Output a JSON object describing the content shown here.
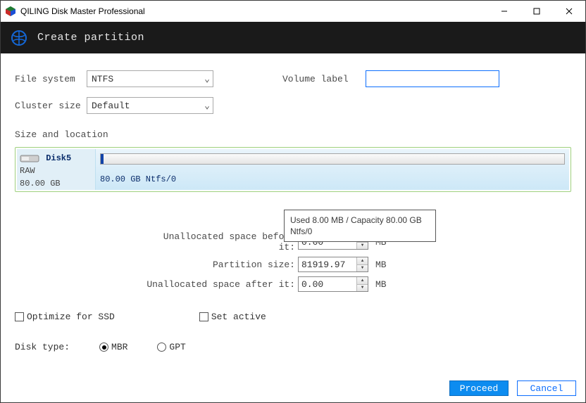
{
  "window": {
    "title": "QILING Disk Master Professional"
  },
  "header": {
    "title": "Create partition"
  },
  "labels": {
    "file_system": "File system",
    "cluster_size": "Cluster size",
    "volume_label": "Volume label",
    "size_location": "Size and location",
    "unalloc_before": "Unallocated space before it:",
    "partition_size": "Partition size:",
    "unalloc_after": "Unallocated space after it:",
    "unit_mb": "MB",
    "optimize_ssd": "Optimize for SSD",
    "set_active": "Set active",
    "disk_type": "Disk type:",
    "mbr": "MBR",
    "gpt": "GPT"
  },
  "values": {
    "file_system": "NTFS",
    "cluster_size": "Default",
    "volume_label": "",
    "unalloc_before": "0.00",
    "partition_size": "81919.97",
    "unalloc_after": "0.00",
    "disk_type_selected": "MBR"
  },
  "disk": {
    "name": "Disk5",
    "raw": "RAW",
    "capacity": "80.00 GB",
    "segment_label": "80.00 GB Ntfs/0"
  },
  "tooltip": {
    "line1": "Used 8.00 MB / Capacity 80.00 GB",
    "line2": "Ntfs/0"
  },
  "buttons": {
    "proceed": "Proceed",
    "cancel": "Cancel"
  }
}
